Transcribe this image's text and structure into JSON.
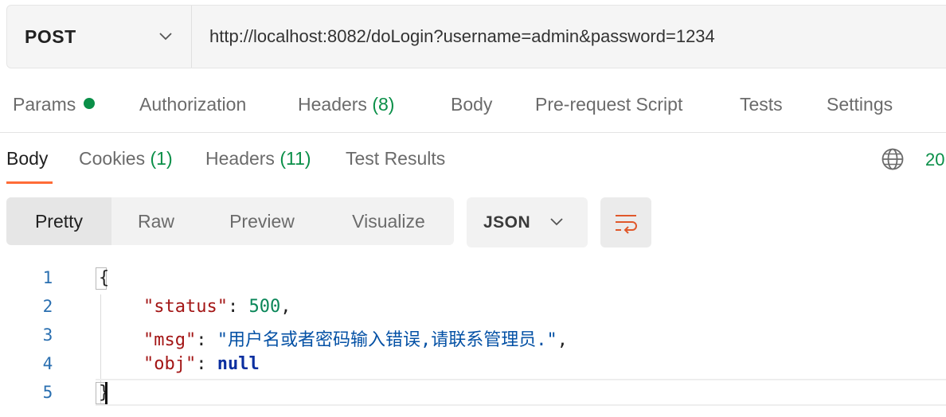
{
  "request": {
    "method": "POST",
    "url": "http://localhost:8082/doLogin?username=admin&password=1234"
  },
  "request_tabs": [
    {
      "label": "Params",
      "has_dot": true
    },
    {
      "label": "Authorization"
    },
    {
      "label": "Headers",
      "count": "(8)"
    },
    {
      "label": "Body"
    },
    {
      "label": "Pre-request Script"
    },
    {
      "label": "Tests"
    },
    {
      "label": "Settings"
    }
  ],
  "response_tabs": [
    {
      "label": "Body",
      "active": true
    },
    {
      "label": "Cookies",
      "count": "(1)"
    },
    {
      "label": "Headers",
      "count": "(11)"
    },
    {
      "label": "Test Results"
    }
  ],
  "response_status_partial": "20",
  "format_modes": [
    "Pretty",
    "Raw",
    "Preview",
    "Visualize"
  ],
  "active_format": "Pretty",
  "language": "JSON",
  "code": {
    "line_numbers": [
      "1",
      "2",
      "3",
      "4",
      "5"
    ],
    "open_brace": "{",
    "close_brace": "}",
    "status_key": "\"status\"",
    "status_value": "500",
    "msg_key": "\"msg\"",
    "msg_value": "\"用户名或者密码输入错误,请联系管理员.\"",
    "obj_key": "\"obj\"",
    "obj_value": "null",
    "colon": ": ",
    "comma": ","
  },
  "colors": {
    "accent_orange": "#ff6c37",
    "count_green": "#0a8f48",
    "json_key": "#a31515",
    "json_string": "#0451a5",
    "json_number": "#098658"
  }
}
